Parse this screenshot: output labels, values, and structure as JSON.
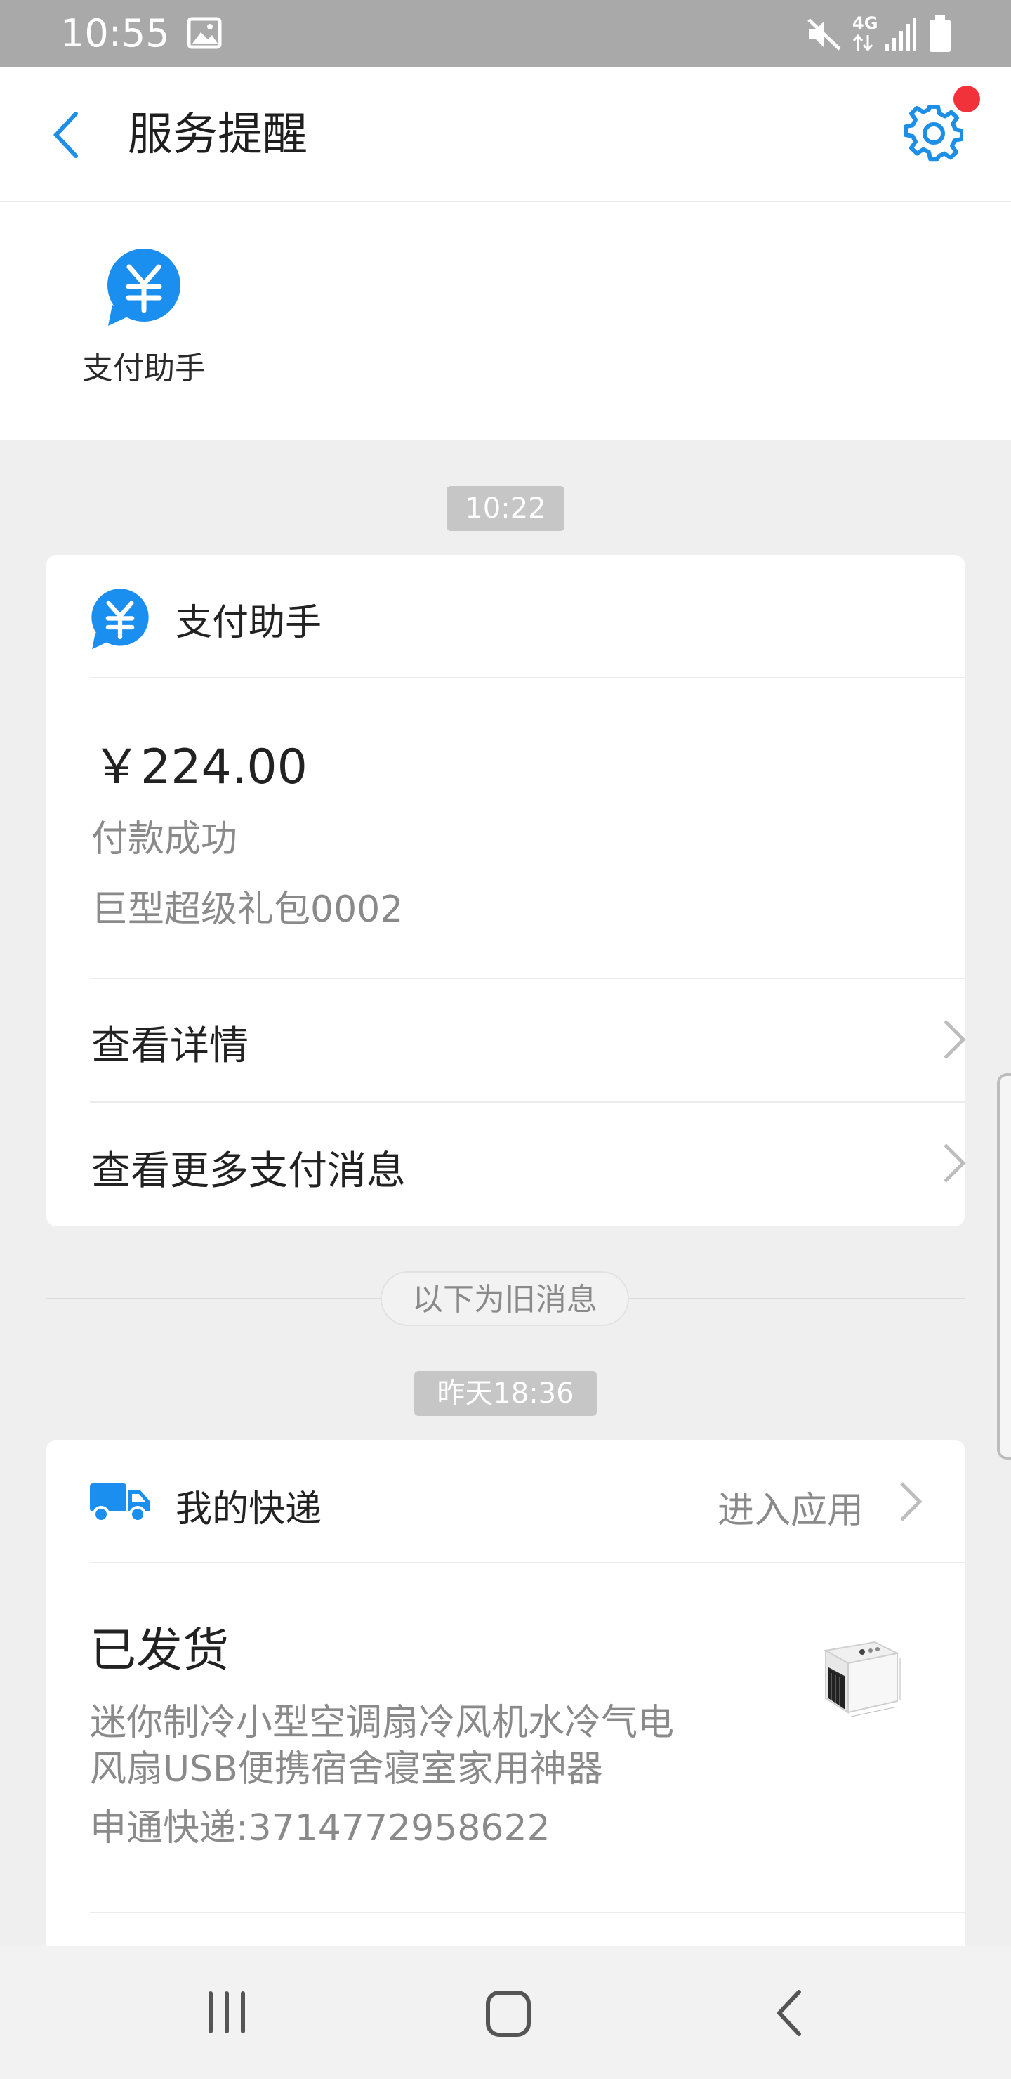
{
  "status_bar": {
    "time": "10:55",
    "network": "4G",
    "icons": [
      "image-icon",
      "mute-icon",
      "signal-icon",
      "battery-icon"
    ]
  },
  "header": {
    "title": "服务提醒",
    "back_icon": "back-arrow-icon",
    "settings_icon": "gear-icon",
    "notify_color": "#f2323a"
  },
  "service_strip": {
    "items": [
      {
        "label": "支付助手",
        "icon": "yuan-bubble-icon"
      }
    ]
  },
  "colors": {
    "accent": "#1e8fe6",
    "icon_blue": "#1a8ff0"
  },
  "timestamps": {
    "first": "10:22",
    "old_divider": "以下为旧消息",
    "second": "昨天18:36"
  },
  "payment_card": {
    "source": "支付助手",
    "amount": "￥224.00",
    "status": "付款成功",
    "item": "巨型超级礼包0002",
    "actions": [
      {
        "label": "查看详情"
      },
      {
        "label": "查看更多支付消息"
      }
    ]
  },
  "express_card": {
    "source": "我的快递",
    "enter_app": "进入应用",
    "status": "已发货",
    "desc_line1": "迷你制冷小型空调扇冷风机水冷气电",
    "desc_line2": "风扇USB便携宿舍寝室家用神器",
    "tracking": "申通快递:3714772958622"
  },
  "nav": {
    "icons": [
      "recent-apps-icon",
      "home-icon",
      "back-icon"
    ]
  }
}
